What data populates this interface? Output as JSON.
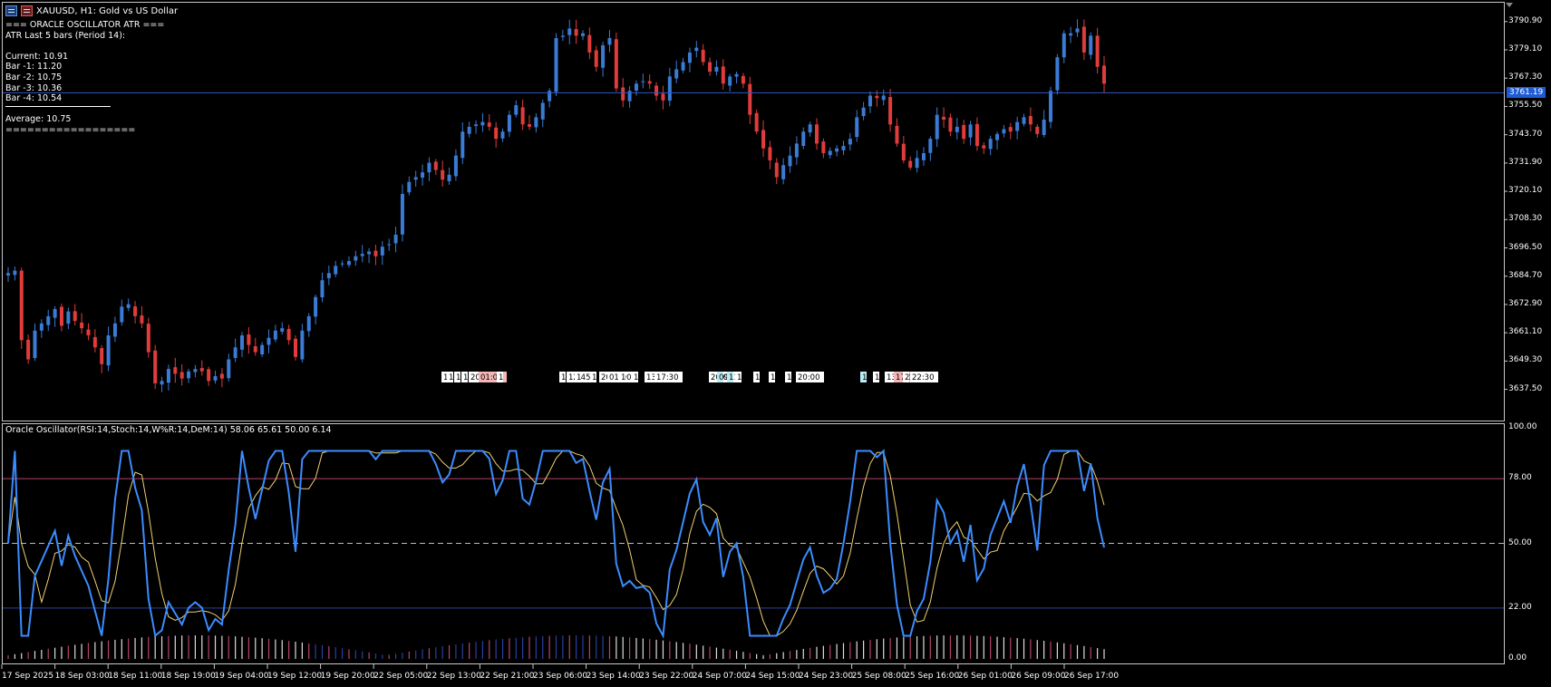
{
  "header": {
    "symbol": "XAUUSD, H1:  Gold vs US Dollar"
  },
  "indicator_panel": {
    "lines": [
      "=== ORACLE OSCILLATOR ATR ===",
      "ATR Last 5 bars (Period 14):",
      "",
      "Current: 10.91",
      "Bar -1: 11.20",
      "Bar -2: 10.75",
      "Bar -3: 10.36",
      "Bar -4: 10.54",
      "",
      "Average: 10.75",
      "=================="
    ]
  },
  "oscillator": {
    "label": "Oracle Oscillator(RSI:14,Stoch:14,W%R:14,DeM:14) 58.06 65.61 50.00 6.14"
  },
  "price_axis": {
    "ticks": [
      "3790.90",
      "3779.10",
      "3767.30",
      "3755.50",
      "3743.70",
      "3731.90",
      "3720.10",
      "3708.30",
      "3696.50",
      "3684.70",
      "3672.90",
      "3661.10",
      "3649.30",
      "3637.50"
    ],
    "current_price": "3761.19"
  },
  "osc_axis": {
    "ticks": [
      "100.00",
      "78.00",
      "50.00",
      "22.00",
      "0.00"
    ]
  },
  "time_axis": {
    "labels": [
      "17 Sep 2025",
      "18 Sep 03:00",
      "18 Sep 11:00",
      "18 Sep 19:00",
      "19 Sep 04:00",
      "19 Sep 12:00",
      "19 Sep 20:00",
      "22 Sep 05:00",
      "22 Sep 13:00",
      "22 Sep 21:00",
      "23 Sep 06:00",
      "23 Sep 14:00",
      "23 Sep 22:00",
      "24 Sep 07:00",
      "24 Sep 15:00",
      "24 Sep 23:00",
      "25 Sep 08:00",
      "25 Sep 16:00",
      "26 Sep 01:00",
      "26 Sep 09:00",
      "26 Sep 17:00"
    ]
  },
  "event_markers": [
    {
      "text": "1",
      "color": "#ffffff"
    },
    {
      "text": "1",
      "color": "#ffffff"
    },
    {
      "text": "1",
      "color": "#ffffff"
    },
    {
      "text": "1",
      "color": "#ffffff"
    },
    {
      "text": "20:30",
      "color": "#ffffff"
    },
    {
      "text": "01:00",
      "color": "#f4b6b6"
    },
    {
      "text": "1",
      "color": "#ffffff"
    },
    {
      "text": "1",
      "color": "#ffffff"
    },
    {
      "text": "12:45",
      "color": "#ffffff"
    },
    {
      "text": "1",
      "color": "#ffffff"
    },
    {
      "text": "17",
      "color": "#ffffff"
    },
    {
      "text": "20:00",
      "color": "#ffffff"
    },
    {
      "text": "01:00",
      "color": "#ffffff"
    },
    {
      "text": "1",
      "color": "#ffffff"
    },
    {
      "text": "11",
      "color": "#ffffff"
    },
    {
      "text": "13:36",
      "color": "#ffffff"
    },
    {
      "text": "17:30",
      "color": "#ffffff"
    },
    {
      "text": "20:00",
      "color": "#ffffff"
    },
    {
      "text": "09",
      "color": "#b9eef5"
    },
    {
      "text": "11",
      "color": "#b9eef5"
    },
    {
      "text": "13",
      "color": "#ffffff"
    },
    {
      "text": "1",
      "color": "#ffffff"
    },
    {
      "text": "1",
      "color": "#ffffff"
    },
    {
      "text": "18",
      "color": "#ffffff"
    },
    {
      "text": "20:00",
      "color": "#ffffff"
    },
    {
      "text": "1",
      "color": "#b9eef5"
    },
    {
      "text": "1",
      "color": "#ffffff"
    },
    {
      "text": "13:58",
      "color": "#ffffff"
    },
    {
      "text": "17:00",
      "color": "#f4b6b6"
    },
    {
      "text": "20",
      "color": "#ffffff"
    },
    {
      "text": "22:30",
      "color": "#ffffff"
    }
  ],
  "colors": {
    "bull": "#3a7bd5",
    "bear": "#e03c3c",
    "osc_main": "#3c8cff",
    "osc_signal": "#f0d070",
    "level_78": "#b8446e",
    "level_22": "#2a3fa0",
    "level_50": "#bbbbbb",
    "price_line": "#2c57c8"
  },
  "chart_data": {
    "type": "candlestick",
    "price_range": [
      3626.0,
      3798.0
    ],
    "current_price": 3761.19,
    "closes": [
      3686.0,
      3687.0,
      3658.0,
      3650.0,
      3662.0,
      3665.0,
      3668.0,
      3671.0,
      3664.0,
      3670.0,
      3666.0,
      3663.0,
      3660.0,
      3655.0,
      3648.0,
      3660.0,
      3665.0,
      3672.0,
      3673.0,
      3668.0,
      3665.0,
      3653.0,
      3640.0,
      3641.0,
      3646.0,
      3644.0,
      3642.0,
      3645.0,
      3646.0,
      3645.0,
      3641.0,
      3643.0,
      3642.0,
      3650.0,
      3655.0,
      3660.0,
      3656.0,
      3653.0,
      3656.0,
      3659.0,
      3662.0,
      3663.0,
      3658.0,
      3651.0,
      3662.0,
      3668.0,
      3676.0,
      3683.0,
      3686.0,
      3689.0,
      3690.0,
      3691.0,
      3693.0,
      3694.0,
      3695.0,
      3693.0,
      3697.0,
      3698.0,
      3702.0,
      3719.0,
      3724.0,
      3726.0,
      3728.0,
      3732.0,
      3729.0,
      3725.0,
      3727.0,
      3735.0,
      3745.0,
      3747.0,
      3748.0,
      3749.0,
      3747.0,
      3742.0,
      3745.0,
      3752.0,
      3756.0,
      3748.0,
      3747.0,
      3751.0,
      3757.0,
      3762.0,
      3784.0,
      3785.0,
      3788.0,
      3785.0,
      3786.0,
      3778.0,
      3772.0,
      3781.0,
      3784.0,
      3763.0,
      3758.0,
      3762.0,
      3765.0,
      3766.0,
      3765.0,
      3760.0,
      3758.0,
      3768.0,
      3771.0,
      3774.0,
      3778.0,
      3780.0,
      3774.0,
      3770.0,
      3772.0,
      3765.0,
      3768.0,
      3769.0,
      3765.0,
      3752.0,
      3745.0,
      3738.0,
      3733.0,
      3726.0,
      3731.0,
      3735.0,
      3740.0,
      3745.0,
      3748.0,
      3740.0,
      3736.0,
      3737.0,
      3738.0,
      3739.0,
      3742.0,
      3751.0,
      3755.0,
      3760.0,
      3759.0,
      3760.0,
      3748.0,
      3740.0,
      3733.0,
      3730.0,
      3734.0,
      3736.0,
      3742.0,
      3752.0,
      3750.0,
      3745.0,
      3747.0,
      3742.0,
      3748.0,
      3739.0,
      3738.0,
      3742.0,
      3744.0,
      3746.0,
      3745.0,
      3749.0,
      3751.0,
      3748.0,
      3744.0,
      3750.0,
      3762.0,
      3776.0,
      3786.0,
      3786.0,
      3788.0,
      3778.0,
      3785.0,
      3772.0,
      3765.0
    ]
  }
}
